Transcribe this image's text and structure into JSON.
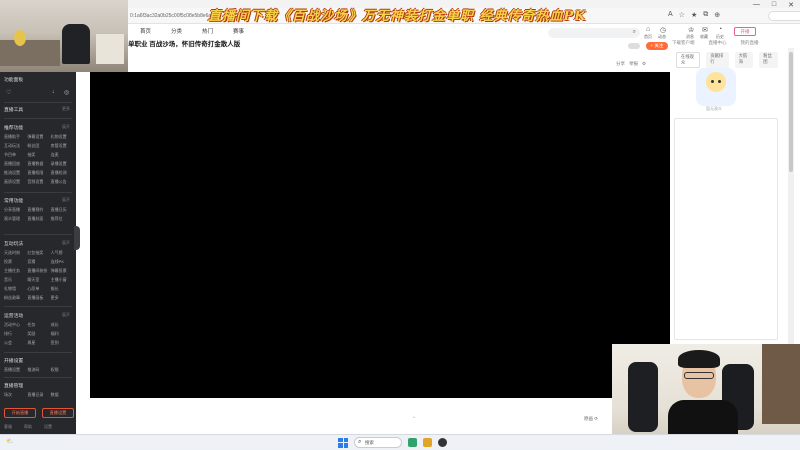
{
  "browser": {
    "url": "0:1a6f3ac32a0b25c00f5c08e5b8e6a0d2",
    "search_placeholder": "",
    "window_controls": [
      "—",
      "□",
      "✕"
    ],
    "toolbar_icons": [
      "A",
      "☆",
      "★",
      "⧉",
      "⊕"
    ]
  },
  "banner": {
    "text": "直播间下载《百战沙场》万无神装打金单职 经典传奇热血PK"
  },
  "site": {
    "nav": [
      "首页",
      "分类",
      "热门",
      "赛事"
    ],
    "room_title": "单职业 百战沙场，怀旧传奇打金散人版",
    "room_meta": "",
    "badge": "",
    "follow_label": "+ 关注",
    "player_tools": [
      "分享",
      "举报",
      "⚙"
    ]
  },
  "user_area": {
    "icons": [
      {
        "icon": "⌂",
        "label": "首页"
      },
      {
        "icon": "◷",
        "label": "动态"
      },
      {
        "icon": "♔",
        "label": "消息"
      },
      {
        "icon": "✉",
        "label": "收藏"
      },
      {
        "icon": "◔",
        "label": "历史"
      }
    ],
    "open_live_label": "开播",
    "links": [
      "下载客户端",
      "直播中心",
      "我的直播"
    ]
  },
  "left_panel": {
    "header": "功能面板",
    "sections": [
      {
        "title": "直播工具",
        "more": "更多",
        "items": []
      },
      {
        "title": "推荐功能",
        "more": "展开",
        "items": [
          "直播助手",
          "弹幕设置",
          "礼物设置",
          "互动玩法",
          "粉丝团",
          "房管设置",
          "节目单",
          "抽奖",
          "连麦",
          "直播回放",
          "直播数据",
          "录播设置",
          "推流设置",
          "直播权限",
          "直播检测",
          "画质设置",
          "音频设置",
          "直播公告"
        ]
      },
      {
        "title": "常用功能",
        "more": "展开",
        "items": [
          "分享直播",
          "直播预约",
          "直播日历",
          "观众管理",
          "直播封面",
          "推荐位"
        ]
      },
      {
        "title": "互动玩法",
        "more": "展开",
        "items": [
          "天选时刻",
          "红包抽奖",
          "人气榜",
          "投票",
          "竞猜",
          "连线PK",
          "主播任务",
          "直播间装扮",
          "弹幕投票",
          "音乐",
          "聊天室",
          "主播小窗",
          "礼物墙",
          "心愿单",
          "舰长",
          "粉丝勋章",
          "直播画板",
          "更多"
        ]
      },
      {
        "title": "运营活动",
        "more": "展开",
        "items": [
          "活动中心",
          "任务",
          "成长",
          "排行",
          "奖励",
          "福利",
          "公会",
          "周星",
          "签到"
        ]
      },
      {
        "title": "开播设置",
        "more": "",
        "items": [
          "直播设置",
          "推流码",
          "权限"
        ]
      },
      {
        "title": "直播管理",
        "more": "",
        "items": [
          "场次",
          "直播记录",
          "数据"
        ]
      }
    ],
    "buttons": [
      "开始直播",
      "直播设置"
    ],
    "bottom": [
      "客服",
      "帮助",
      "设置"
    ]
  },
  "right_panel": {
    "tabs": [
      "在线观众",
      "贡献排行",
      "大航海",
      "粉丝团"
    ],
    "mascot_caption": "暂无观众"
  },
  "player_bottom": {
    "speed_label": "原画 ⟳"
  },
  "taskbar": {
    "left": "⛅",
    "search_placeholder": "搜索",
    "apps": [
      {
        "name": "edge",
        "color": "#2fa36b"
      },
      {
        "name": "chrome",
        "color": "#e0a526"
      },
      {
        "name": "obs",
        "color": "#333333"
      }
    ]
  }
}
